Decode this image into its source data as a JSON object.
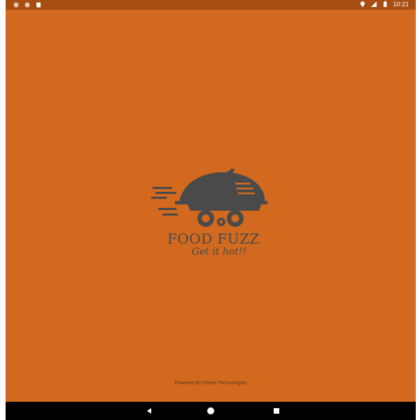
{
  "status_bar": {
    "time": "10:21",
    "icons": [
      "notification-icon",
      "notification-icon",
      "sim-icon",
      "location-icon",
      "signal-icon",
      "battery-icon"
    ]
  },
  "splash": {
    "brand_name": "FOOD FUZZ",
    "tagline": "Get it hot!!",
    "powered_by": "Powered By Otems Technologies"
  },
  "nav_bar": {
    "buttons": [
      "back-icon",
      "home-icon",
      "recents-icon"
    ]
  },
  "colors": {
    "background": "#d2691f",
    "status_bar": "#a84e12",
    "logo": "#4a4a4a",
    "nav_bar": "#000000"
  }
}
